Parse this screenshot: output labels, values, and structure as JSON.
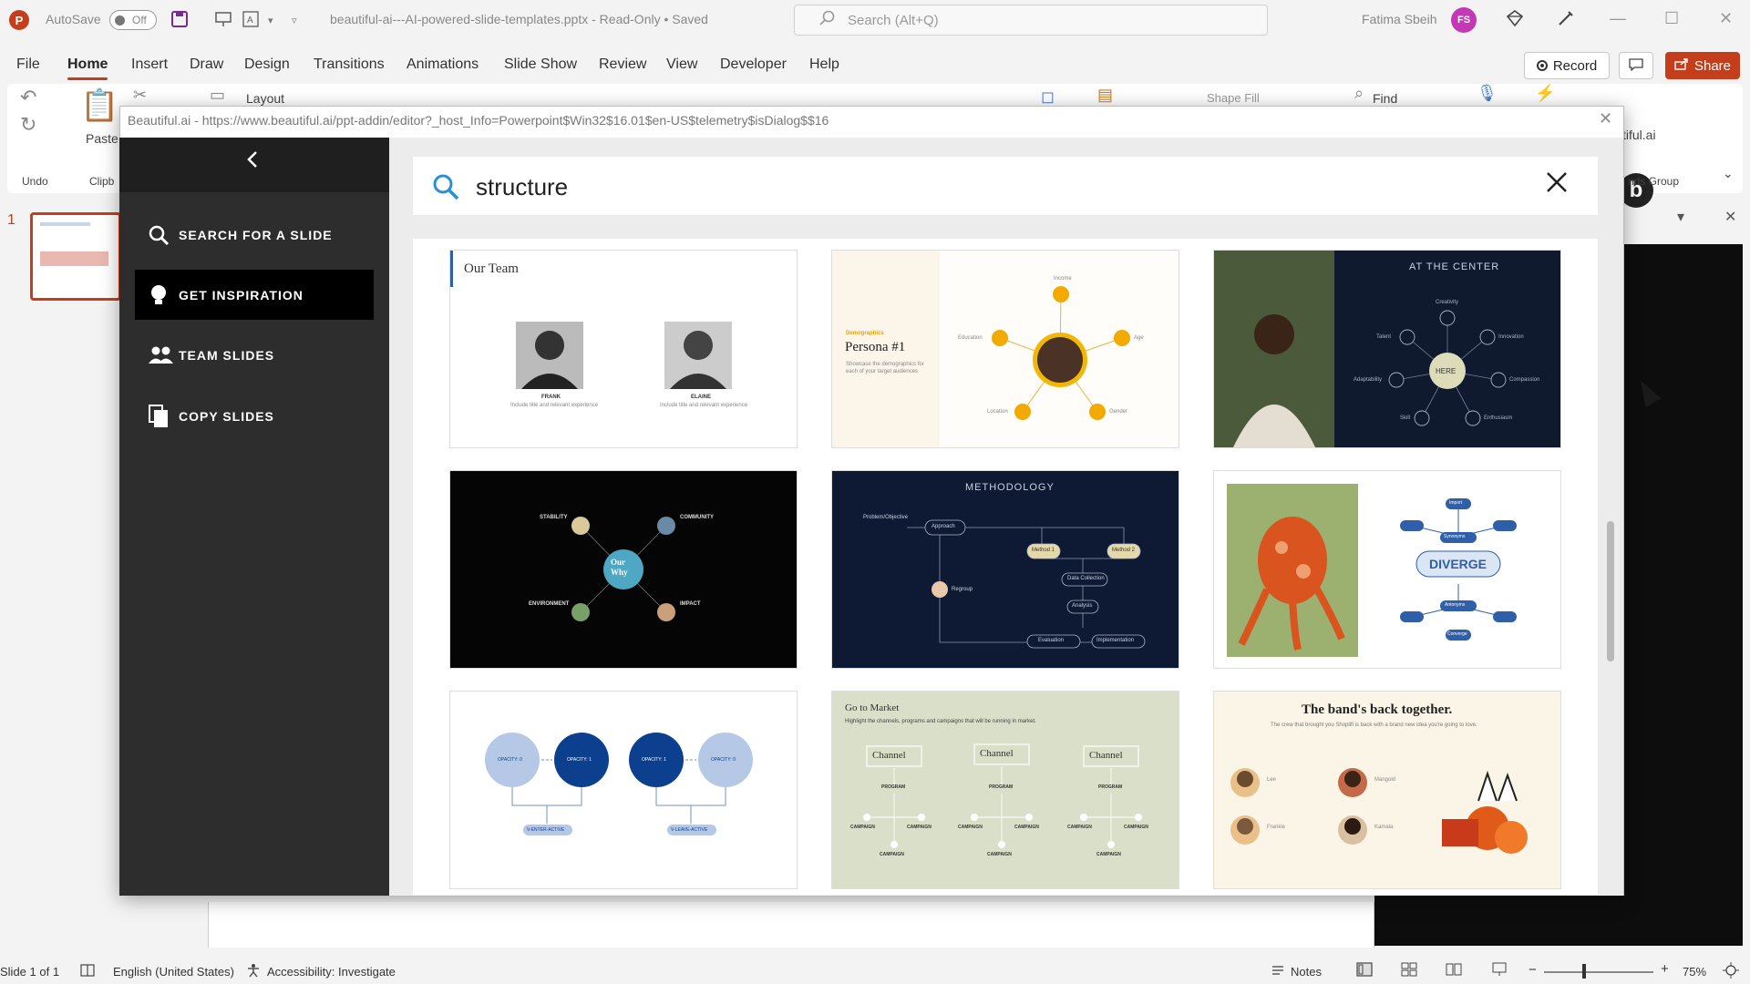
{
  "window": {
    "autosave_label": "AutoSave",
    "autosave_state": "Off",
    "doc_title": "beautiful-ai---AI-powered-slide-templates.pptx  -  Read-Only • Saved",
    "search_placeholder": "Search (Alt+Q)",
    "user_name": "Fatima Sbeih",
    "user_initials": "FS"
  },
  "menu": {
    "tabs": [
      "File",
      "Home",
      "Insert",
      "Draw",
      "Design",
      "Transitions",
      "Animations",
      "Slide Show",
      "Review",
      "View",
      "Developer",
      "Help"
    ],
    "active": "Home",
    "record_label": "Record",
    "share_label": "Share"
  },
  "ribbon": {
    "undo_label": "Undo",
    "paste_label": "Paste",
    "clipboard_label": "Clipb",
    "layout_label": "Layout",
    "shape_fill_label": "Shape Fill",
    "find_label": "Find",
    "addin_label": "tiful.ai",
    "addin_logo": "b",
    "group_label": "nds Group"
  },
  "slides_pane": {
    "slide_number": "1"
  },
  "status": {
    "slide_count": "Slide 1 of 1",
    "language": "English (United States)",
    "accessibility": "Accessibility: Investigate",
    "notes": "Notes",
    "zoom": "75%"
  },
  "dialog": {
    "url": "Beautiful.ai - https://www.beautiful.ai/ppt-addin/editor?_host_Info=Powerpoint$Win32$16.01$en-US$telemetry$isDialog$$16",
    "nav": [
      {
        "label": "SEARCH FOR A SLIDE",
        "icon": "search-icon"
      },
      {
        "label": "GET INSPIRATION",
        "icon": "lightbulb-icon",
        "active": true
      },
      {
        "label": "TEAM SLIDES",
        "icon": "team-icon"
      },
      {
        "label": "COPY SLIDES",
        "icon": "copy-icon"
      }
    ],
    "search_value": "structure",
    "cards": {
      "c1": {
        "title": "Our Team",
        "p1": "FRANK",
        "p2": "ELAINE",
        "p1_sub": "Include title and relevant experience",
        "p2_sub": "Include title and relevant experience"
      },
      "c2": {
        "kicker": "Demographics",
        "title": "Persona #1",
        "body": "Showcase the demographics for each of your target audiences",
        "n1": "Income",
        "n2": "Education",
        "n3": "Age",
        "n4": "Location",
        "n5": "Gender"
      },
      "c3": {
        "title": "AT THE CENTER",
        "center": "HERE",
        "n1": "Creativity",
        "n2": "Talent",
        "n3": "Innovation",
        "n4": "Adaptability",
        "n5": "Compassion",
        "n6": "Skill",
        "n7": "Enthusiasm"
      },
      "c4": {
        "center_l1": "Our",
        "center_l2": "Why",
        "n1": "STABILITY",
        "n2": "COMMUNITY",
        "n3": "ENVIRONMENT",
        "n4": "IMPACT"
      },
      "c5": {
        "title": "METHODOLOGY",
        "n1": "Problem/Objective",
        "n2": "Approach",
        "n3": "Method 1",
        "n4": "Method 2",
        "n5": "Data Collection",
        "n6": "Analysis",
        "n7": "Regroup",
        "n8": "Evaluation",
        "n9": "Implementation"
      },
      "c6": {
        "center": "DIVERGE",
        "n1": "Import",
        "n2": "Synonyms",
        "n3": "Antonyms",
        "n4": "Converge"
      },
      "c7": {
        "n1": "OPACITY: 0",
        "n2": "OPACITY: 1",
        "n3": "OPACITY: 1",
        "n4": "OPACITY: 0",
        "l1": "V-ENTER-ACTIVE",
        "l2": "V-LEAVE-ACTIVE"
      },
      "c8": {
        "title": "Go to Market",
        "sub": "Highlight the channels, programs and campaigns that will be running in market.",
        "ch": "Channel",
        "prog": "PROGRAM",
        "camp": "CAMPAIGN"
      },
      "c9": {
        "title": "The band's back together.",
        "sub": "The crew that brought you Shoplifi is back with a brand new idea you're going to love.",
        "p1": "Lee",
        "p2": "Mangold",
        "p3": "Frankie",
        "p4": "Kamala"
      }
    }
  }
}
